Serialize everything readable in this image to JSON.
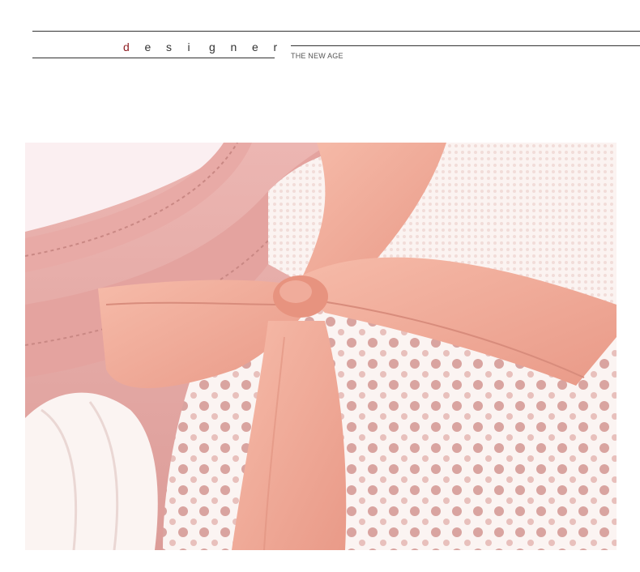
{
  "header": {
    "brand_letters": [
      "d",
      "e",
      "s",
      "i",
      "g",
      "n",
      "e",
      "r"
    ],
    "accent_color": "#8f1f24",
    "tagline": "THE NEW AGE"
  },
  "product_photo": {
    "subject": "pink-satin-bow-on-white-lace-collar",
    "colors": {
      "fabric_pink": "#e6a7a3",
      "ribbon_peach": "#f1aa98",
      "lace_white": "#fbf4f2",
      "background": "#fbeff1"
    }
  }
}
